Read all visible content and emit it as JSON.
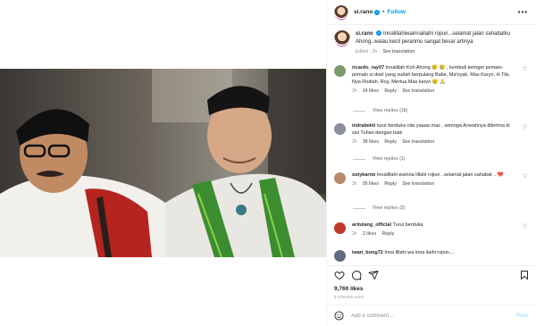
{
  "post": {
    "username": "si.rano",
    "follow_label": "Follow",
    "more_label": "•••",
    "caption_text": "Innalillahiwainnailaihi rojiun...selamat jalan sahabatku Ahong..walau kecil peranmu sangat besar artinya",
    "caption_time": "Edited · 2h",
    "caption_see_translation": "See translation"
  },
  "comments": [
    {
      "username": "ricardo_ray07",
      "text": "Innalillah Koh Ahong 😢 😢 , kembali teringet pemain-pemain si doel yang sudah berpulang Babe, Ma'nyak, Mas Karyo, H.Tile, Nya Rodiah, Roy, Mertua Mas karyo 😢 🙏",
      "time": "3h",
      "likes": "24 likes",
      "reply": "Reply",
      "see_translation": "See translation",
      "view_replies": "View replies (18)",
      "avatar_color": "#7a9b6b"
    },
    {
      "username": "indrabekti",
      "text": "turut berduka cita yaaaa mas , semoga Anwahnya diterima di sisi Tuhan dengan baik",
      "time": "2h",
      "likes": "39 likes",
      "reply": "Reply",
      "see_translation": "See translation",
      "view_replies": "View replies (1)",
      "avatar_color": "#8a8f99"
    },
    {
      "username": "sutykarno",
      "text": "Innalillahi wainna lillahi rojiun ..selamat jalan sahabat .. 💔",
      "time": "3h",
      "likes": "55 likes",
      "reply": "Reply",
      "see_translation": "See translation",
      "view_replies": "View replies (2)",
      "avatar_color": "#b98a6a"
    },
    {
      "username": "aritulang_official",
      "text": "Turut berduka",
      "time": "2h",
      "likes": "2 likes",
      "reply": "Reply",
      "avatar_color": "#c0392b"
    },
    {
      "username": "iwan_bong72",
      "text": "Inna lillahi wa inna ilaihi rojiun....",
      "avatar_color": "#5d6d7e"
    }
  ],
  "stats": {
    "likes": "9,760 likes",
    "time_ago": "3 HOURS AGO"
  },
  "composer": {
    "placeholder": "Add a comment...",
    "post_label": "Post"
  },
  "icons": {
    "like": "heart-icon",
    "comment": "comment-icon",
    "share": "share-icon",
    "save": "bookmark-icon",
    "emoji": "emoji-icon"
  },
  "colors": {
    "accent": "#0095f6",
    "muted": "#8e8e8e",
    "post_disabled": "#b2dffc"
  }
}
